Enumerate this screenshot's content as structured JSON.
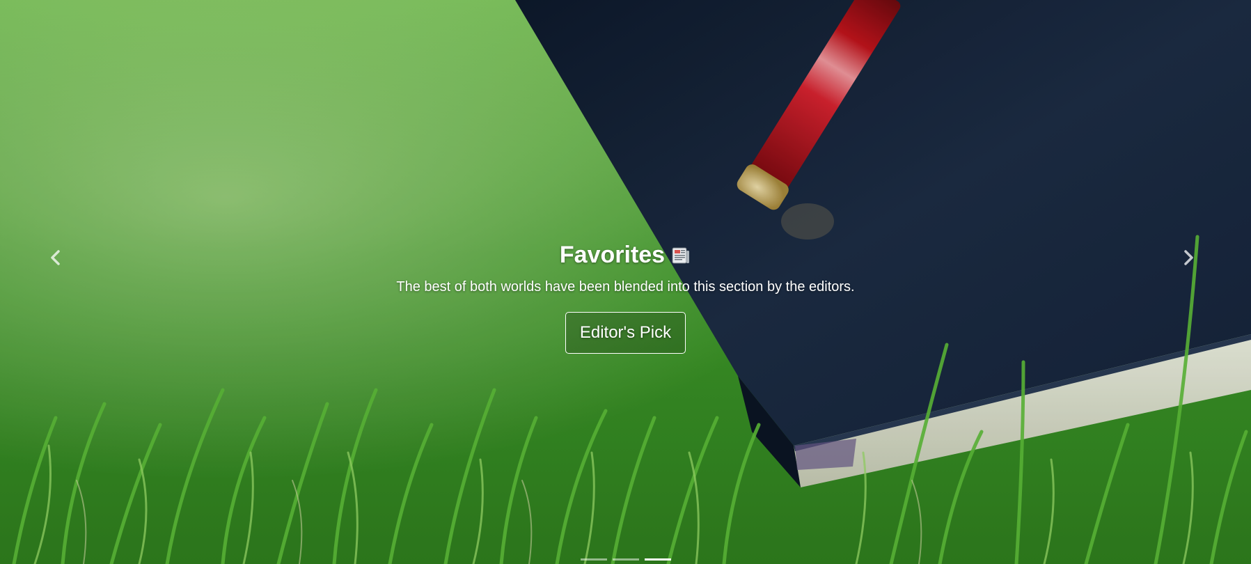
{
  "carousel": {
    "slide": {
      "title": "Favorites",
      "title_icon": "newspaper-icon",
      "description": "The best of both worlds have been blended into this section by the editors.",
      "button_label": "Editor's Pick",
      "background": "green grass with dark notebook and red pen"
    },
    "controls": {
      "prev_icon": "chevron-left-icon",
      "next_icon": "chevron-right-icon"
    },
    "indicators": {
      "count": 3,
      "active_index": 2
    },
    "colors": {
      "caption_text": "#ffffff",
      "grass": "#4fa82c",
      "notebook": "#1b2a40",
      "pen": "#b3131a"
    }
  }
}
